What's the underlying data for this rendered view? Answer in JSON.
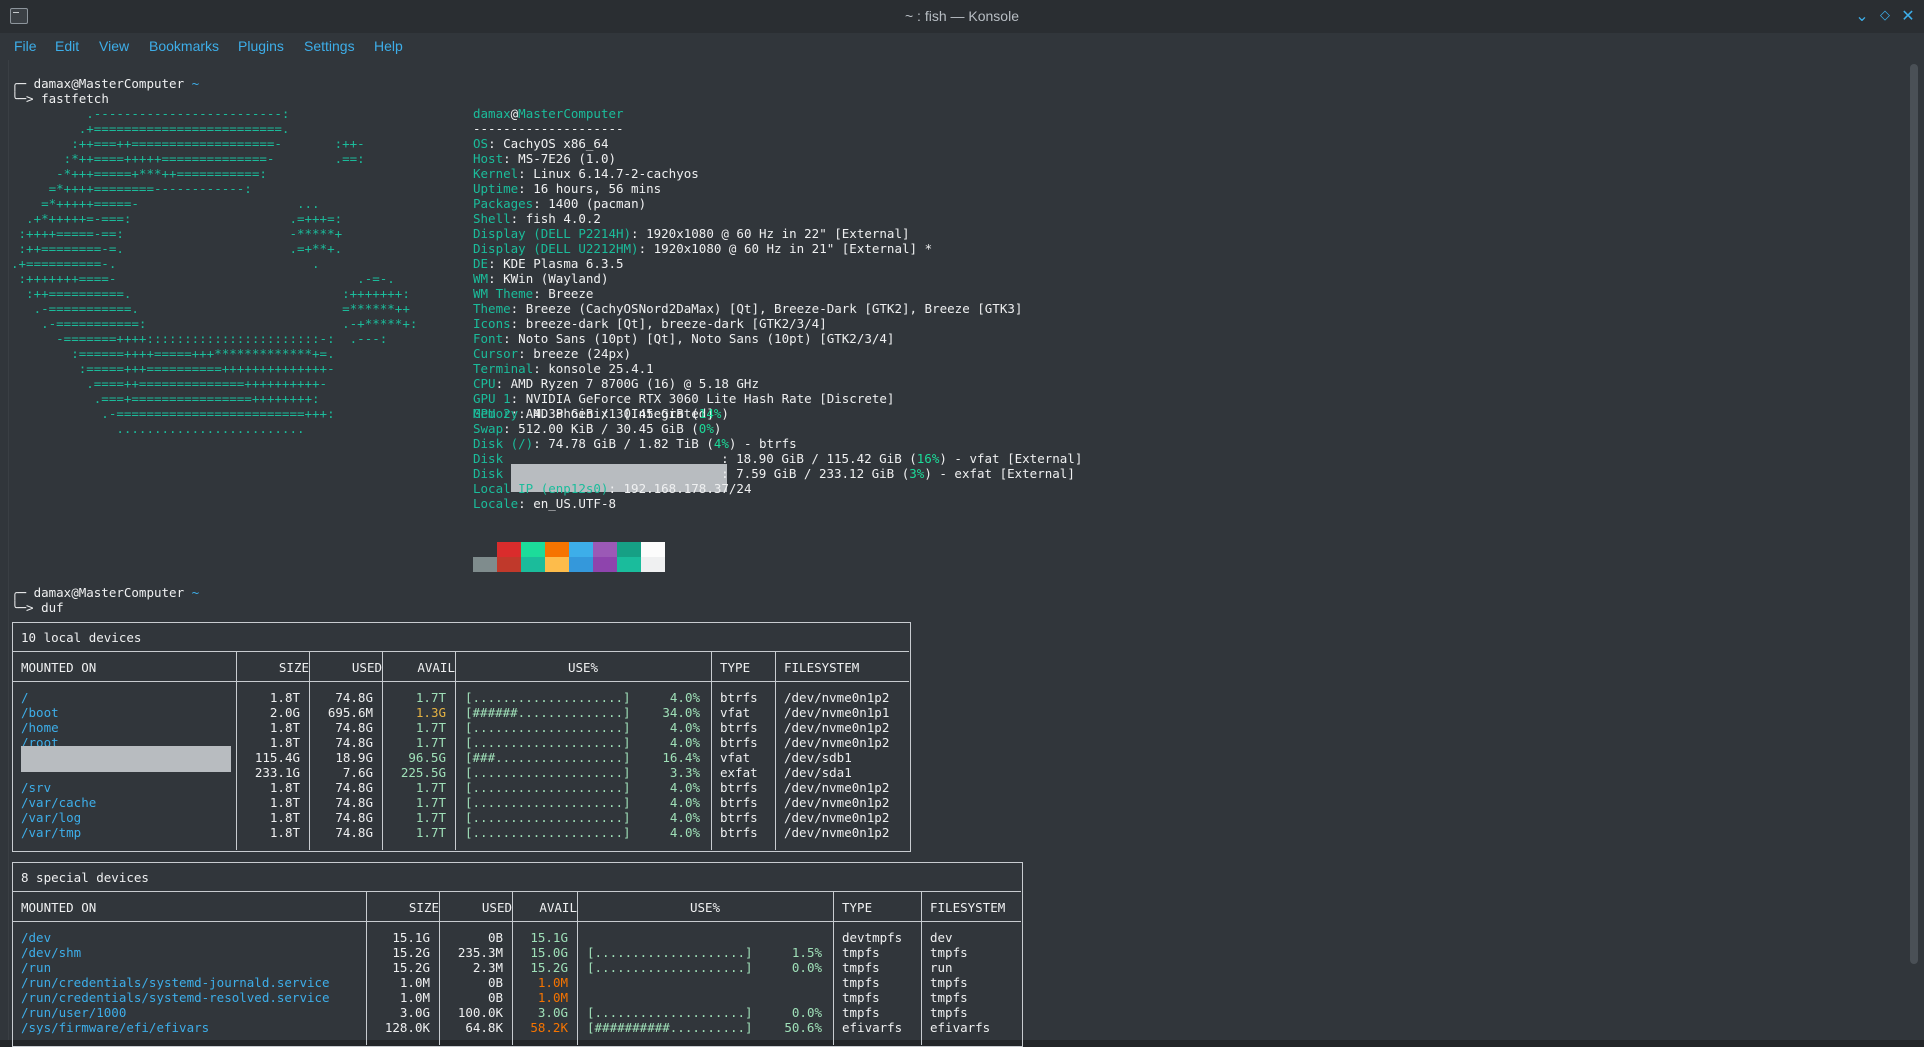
{
  "window": {
    "title": "~ : fish — Konsole"
  },
  "menu": [
    "File",
    "Edit",
    "View",
    "Bookmarks",
    "Plugins",
    "Settings",
    "Help"
  ],
  "prompt1": {
    "user": "damax@MasterComputer",
    "tilde": "~",
    "cmd": "fastfetch"
  },
  "logo": [
    "          .-------------------------:",
    "         .+=========================.",
    "        :++===++===================-       :++-",
    "       :*++====+++++==============-        .==:",
    "      -*+++=====+***++===========:",
    "     =*++++========------------:",
    "    =*+++++=====-                     ...",
    "  .+*+++++=-===:                     .=+++=:",
    " :++++=====-==:                      -*****+",
    " :++========-=.                      .=+**+.",
    ".+==========-.                          .",
    " :+++++++====-                                .-=-.",
    "  :++==========.                            :+++++++:",
    "   .-===========.                           =******++",
    "    .-===========:                          .-+*****+:",
    "      -=======++++:::::::::::::::::::::::-:  .---:",
    "        :======++++=====+++*************+=.",
    "         :=====+++==========++++++++++++++-",
    "          .====++==============++++++++++-",
    "           .===+================++++++++:",
    "            .-=========================+++:",
    "              ........................."
  ],
  "fetch": {
    "user": "damax",
    "at": "@",
    "host": "MasterComputer",
    "sep": "--------------------",
    "rows": [
      {
        "label": "OS",
        "value": "CachyOS x86_64"
      },
      {
        "label": "Host",
        "value": "MS-7E26 (1.0)"
      },
      {
        "label": "Kernel",
        "value": "Linux 6.14.7-2-cachyos"
      },
      {
        "label": "Uptime",
        "value": "16 hours, 56 mins"
      },
      {
        "label": "Packages",
        "value": "1400 (pacman)"
      },
      {
        "label": "Shell",
        "value": "fish 4.0.2"
      },
      {
        "label": "Display (DELL P2214H)",
        "value": "1920x1080 @ 60 Hz in 22\" [External]"
      },
      {
        "label": "Display (DELL U2212HM)",
        "value": "1920x1080 @ 60 Hz in 21\" [External] *"
      },
      {
        "label": "DE",
        "value": "KDE Plasma 6.3.5"
      },
      {
        "label": "WM",
        "value": "KWin (Wayland)"
      },
      {
        "label": "WM Theme",
        "value": "Breeze"
      },
      {
        "label": "Theme",
        "value": "Breeze (CachyOSNord2DaMax) [Qt], Breeze-Dark [GTK2], Breeze [GTK3]"
      },
      {
        "label": "Icons",
        "value": "breeze-dark [Qt], breeze-dark [GTK2/3/4]"
      },
      {
        "label": "Font",
        "value": "Noto Sans (10pt) [Qt], Noto Sans (10pt) [GTK2/3/4]"
      },
      {
        "label": "Cursor",
        "value": "breeze (24px)"
      },
      {
        "label": "Terminal",
        "value": "konsole 25.4.1"
      },
      {
        "label": "CPU",
        "value": "AMD Ryzen 7 8700G (16) @ 5.18 GHz"
      },
      {
        "label": "GPU 1",
        "value": "NVIDIA GeForce RTX 3060 Lite Hash Rate [Discrete]"
      },
      {
        "label": "GPU 2",
        "value": "AMD Phoenix1 [Integrated]"
      }
    ],
    "memory": {
      "label": "Memory",
      "a": "4.38 GiB / 30.45 GiB (",
      "p": "14%",
      "b": ")"
    },
    "swap": {
      "label": "Swap",
      "a": "512.00 KiB / 30.45 GiB (",
      "p": "0%",
      "b": ")"
    },
    "disk_root": {
      "label": "Disk (/)",
      "a": "74.78 GiB / 1.82 TiB (",
      "p": "4%",
      "b": ") - btrfs"
    },
    "disk2": {
      "label": "Disk",
      "a": ": 18.90 GiB / 115.42 GiB (",
      "p": "16%",
      "b": ") - vfat [External]"
    },
    "disk3": {
      "label": "Disk",
      "a": ": 7.59 GiB / 233.12 GiB (",
      "p": "3%",
      "b": ") - exfat [External]"
    },
    "localip": {
      "label": "Local IP (enp12s0)",
      "value": "192.168.178.37/24"
    },
    "locale": {
      "label": "Locale",
      "value": "en_US.UTF-8"
    },
    "palette_top": [
      "#31363b",
      "#da2c2c",
      "#1cdc9a",
      "#f67400",
      "#3daee9",
      "#9b59b6",
      "#16a085",
      "#fcfcfc"
    ],
    "palette_bottom": [
      "#7f8c8d",
      "#c0392b",
      "#1bbc9b",
      "#fdbc4b",
      "#3498db",
      "#8e44ad",
      "#1abc9c",
      "#eff0f1"
    ]
  },
  "prompt2": {
    "user": "damax@MasterComputer",
    "tilde": "~",
    "cmd": "duf"
  },
  "local": {
    "title": "10 local devices",
    "headers": [
      "MOUNTED ON",
      "SIZE",
      "USED",
      "AVAIL",
      "USE%",
      "TYPE",
      "FILESYSTEM"
    ],
    "rows": [
      {
        "m": "/",
        "size": "1.8T",
        "used": "74.8G",
        "avail": "1.7T",
        "bar": "[....................]",
        "pct": "4.0%",
        "type": "btrfs",
        "fs": "/dev/nvme0n1p2"
      },
      {
        "m": "/boot",
        "size": "2.0G",
        "used": "695.6M",
        "avail": "1.3G",
        "bar": "[######..............]",
        "pct": "34.0%",
        "type": "vfat",
        "fs": "/dev/nvme0n1p1"
      },
      {
        "m": "/home",
        "size": "1.8T",
        "used": "74.8G",
        "avail": "1.7T",
        "bar": "[....................]",
        "pct": "4.0%",
        "type": "btrfs",
        "fs": "/dev/nvme0n1p2"
      },
      {
        "m": "/root",
        "size": "1.8T",
        "used": "74.8G",
        "avail": "1.7T",
        "bar": "[....................]",
        "pct": "4.0%",
        "type": "btrfs",
        "fs": "/dev/nvme0n1p2"
      },
      {
        "m": "",
        "size": "115.4G",
        "used": "18.9G",
        "avail": "96.5G",
        "bar": "[###.................]",
        "pct": "16.4%",
        "type": "vfat",
        "fs": "/dev/sdb1"
      },
      {
        "m": "",
        "size": "233.1G",
        "used": "7.6G",
        "avail": "225.5G",
        "bar": "[....................]",
        "pct": "3.3%",
        "type": "exfat",
        "fs": "/dev/sda1"
      },
      {
        "m": "/srv",
        "size": "1.8T",
        "used": "74.8G",
        "avail": "1.7T",
        "bar": "[....................]",
        "pct": "4.0%",
        "type": "btrfs",
        "fs": "/dev/nvme0n1p2"
      },
      {
        "m": "/var/cache",
        "size": "1.8T",
        "used": "74.8G",
        "avail": "1.7T",
        "bar": "[....................]",
        "pct": "4.0%",
        "type": "btrfs",
        "fs": "/dev/nvme0n1p2"
      },
      {
        "m": "/var/log",
        "size": "1.8T",
        "used": "74.8G",
        "avail": "1.7T",
        "bar": "[....................]",
        "pct": "4.0%",
        "type": "btrfs",
        "fs": "/dev/nvme0n1p2"
      },
      {
        "m": "/var/tmp",
        "size": "1.8T",
        "used": "74.8G",
        "avail": "1.7T",
        "bar": "[....................]",
        "pct": "4.0%",
        "type": "btrfs",
        "fs": "/dev/nvme0n1p2"
      }
    ]
  },
  "special": {
    "title": "8 special devices",
    "headers": [
      "MOUNTED ON",
      "SIZE",
      "USED",
      "AVAIL",
      "USE%",
      "TYPE",
      "FILESYSTEM"
    ],
    "rows": [
      {
        "m": "/dev",
        "size": "15.1G",
        "used": "0B",
        "avail": "15.1G",
        "bar": "",
        "pct": "",
        "type": "devtmpfs",
        "fs": "dev"
      },
      {
        "m": "/dev/shm",
        "size": "15.2G",
        "used": "235.3M",
        "avail": "15.0G",
        "bar": "[....................]",
        "pct": "1.5%",
        "type": "tmpfs",
        "fs": "tmpfs"
      },
      {
        "m": "/run",
        "size": "15.2G",
        "used": "2.3M",
        "avail": "15.2G",
        "bar": "[....................]",
        "pct": "0.0%",
        "type": "tmpfs",
        "fs": "run"
      },
      {
        "m": "/run/credentials/systemd-journald.service",
        "size": "1.0M",
        "used": "0B",
        "avail": "1.0M",
        "bar": "",
        "pct": "",
        "type": "tmpfs",
        "fs": "tmpfs"
      },
      {
        "m": "/run/credentials/systemd-resolved.service",
        "size": "1.0M",
        "used": "0B",
        "avail": "1.0M",
        "bar": "",
        "pct": "",
        "type": "tmpfs",
        "fs": "tmpfs"
      },
      {
        "m": "/run/user/1000",
        "size": "3.0G",
        "used": "100.0K",
        "avail": "3.0G",
        "bar": "[....................]",
        "pct": "0.0%",
        "type": "tmpfs",
        "fs": "tmpfs"
      },
      {
        "m": "/sys/firmware/efi/efivars",
        "size": "128.0K",
        "used": "64.8K",
        "avail": "58.2K",
        "bar": "[##########..........]",
        "pct": "50.6%",
        "type": "efivarfs",
        "fs": "efivarfs"
      }
    ]
  }
}
